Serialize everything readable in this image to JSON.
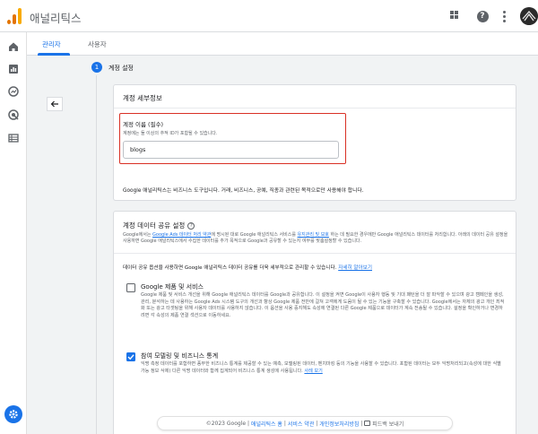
{
  "app": {
    "title": "애널리틱스"
  },
  "header": {
    "icons": [
      "apps-grid-icon",
      "help-icon",
      "more-vert-icon",
      "account-avatar"
    ]
  },
  "sidebar": {
    "icons": [
      "home-icon",
      "reports-icon",
      "explore-icon",
      "advertising-icon",
      "configure-icon",
      "admin-gear-icon"
    ]
  },
  "tabs": [
    {
      "label": "관리자",
      "active": true
    },
    {
      "label": "사용자",
      "active": false
    }
  ],
  "stepper": {
    "number": "1",
    "label": "계정 설정"
  },
  "account_details": {
    "title": "계정 세부정보",
    "field_label": "계정 이름 (필수)",
    "field_help": "계정에는 둘 이상의 추적 ID가 포함될 수 있습니다.",
    "field_value": "blogs",
    "footer": "Google 애널리틱스는 비즈니스 도구입니다. 거래, 비즈니스, 공예, 직종과 관련된 목적으로만 사용해야 합니다."
  },
  "data_sharing": {
    "title": "계정 데이터 공유 설정",
    "help_glyph": "?",
    "desc_1": "Google에서는",
    "desc_link_1": "Google Ads 데이터 처리 약관",
    "desc_2": "에 명시된 대로 Google 애널리틱스 서비스를",
    "desc_link_2": "유지관리 및 보호",
    "desc_3": "하는 데 필요한 경우에만 Google 애널리틱스 데이터를 처리합니다. 아래의 데이터 공유 설정을 사용하면 Google 애널리틱스에서 수집한 데이터를 추가 목적으로 Google과 공유할 수 있는지 여부를 맞춤설정할 수 있습니다.",
    "intro": "데이터 공유 옵션을 사용하면 Google 애널리틱스 데이터 공유를 더욱 세부적으로 관리할 수 있습니다.",
    "intro_link": "자세히 알아보기",
    "options": [
      {
        "title": "Google 제품 및 서비스",
        "checked": false,
        "desc": "Google 제품 및 서비스 개선을 위해 Google 애널리틱스 데이터를 Google과 공유합니다. 이 설정을 켜면 Google이 사용자 행동 및 기대 패턴을 더 잘 파악할 수 있으며 광고 캠페인을 생성, 관리, 분석하는 데 사용하는 Google Ads 시스템 도구의 개선과 향상 Google 제품 전반에 걸쳐 고객에게 도움이 될 수 있는 기능을 구축할 수 있습니다. Google에서는 자체의 광고 개인 최적화 또는 광고 타겟팅을 위해 사용자 데이터를 사용하지 않습니다. 이 옵션을 사용 중지해도 속성에 연결된 다른 Google 제품으로 데이터가 계속 전송될 수 있습니다. 설정을 확인하거나 변경하려면 각 속성의 제품 연결 섹션으로 이동하세요."
      },
      {
        "title": "참여 모델링 및 비즈니스 통계",
        "checked": true,
        "desc": "익명 측정 데이터를 포함하면 풍부한 비즈니스 통계를 제공할 수 있는 예측, 모델링된 데이터, 벤치마킹 등의 기능을 사용할 수 있습니다. 포함된 데이터는 모두 익명처리되고(속성에 대한 식별 가능 정보 삭제) 다른 익명 데이터와 함께 집계되어 비즈니스 통계 생성에 사용됩니다.",
        "desc_link": "사례 보기"
      }
    ]
  },
  "footer": {
    "copyright": "©2023 Google",
    "sep": "|",
    "links": [
      "애널리틱스 홈",
      "서비스 약관",
      "개인정보처리방침"
    ],
    "feedback": "피드백 보내기"
  },
  "colors": {
    "accent": "#1a73e8",
    "highlight_border": "#d93025",
    "logo_orange": "#f9ab00"
  }
}
